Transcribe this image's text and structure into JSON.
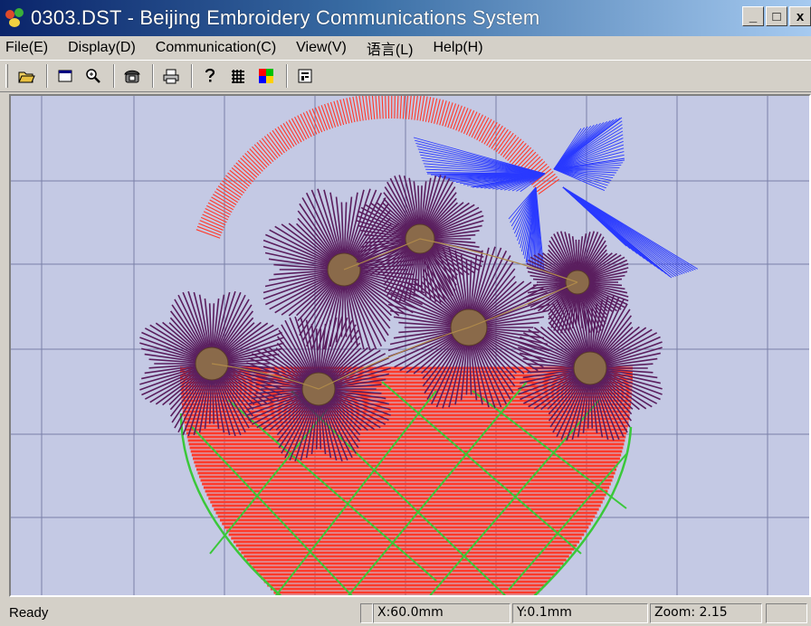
{
  "window": {
    "title": "0303.DST - Beijing Embroidery Communications System",
    "minimize": "_",
    "maximize": "□",
    "close": "x"
  },
  "menu": [
    {
      "label": "File(E)",
      "name": "menu-file"
    },
    {
      "label": "Display(D)",
      "name": "menu-display"
    },
    {
      "label": "Communication(C)",
      "name": "menu-communication"
    },
    {
      "label": "View(V)",
      "name": "menu-view"
    },
    {
      "label": "语言(L)",
      "name": "menu-language"
    },
    {
      "label": "Help(H)",
      "name": "menu-help"
    }
  ],
  "toolbar": {
    "icons": [
      "open-folder-icon",
      "new-window-icon",
      "zoom-icon",
      "telephone-icon",
      "print-icon",
      "help-icon",
      "grid-icon",
      "color-palette-icon",
      "properties-icon"
    ]
  },
  "design": {
    "colors": {
      "handle": "#ff3a2a",
      "bow": "#2a3aff",
      "flower": "#5a1e5e",
      "center": "#8a6a4a",
      "basket": "#ff3a2a",
      "lattice": "#3ac83a",
      "grid": "#7a80a8",
      "background": "#c4c9e4"
    }
  },
  "status": {
    "ready": "Ready",
    "x": "X:60.0mm",
    "y": "Y:0.1mm",
    "zoom": "Zoom: 2.15"
  }
}
